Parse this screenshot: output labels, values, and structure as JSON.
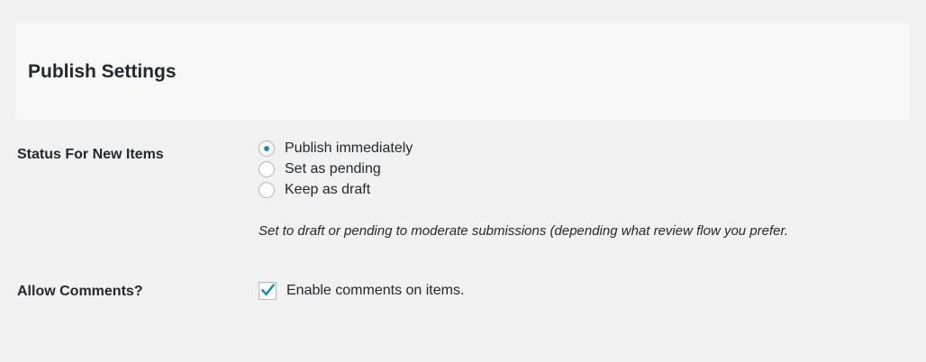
{
  "section": {
    "title": "Publish Settings"
  },
  "status_row": {
    "label": "Status For New Items",
    "options": [
      {
        "label": "Publish immediately",
        "checked": true
      },
      {
        "label": "Set as pending",
        "checked": false
      },
      {
        "label": "Keep as draft",
        "checked": false
      }
    ],
    "description": "Set to draft or pending to moderate submissions (depending what review flow you prefer."
  },
  "comments_row": {
    "label": "Allow Comments?",
    "checkbox_label": "Enable comments on items.",
    "checked": true
  },
  "colors": {
    "accent": "#1e8cbe",
    "background": "#f1f1f1",
    "header_background": "#f8f8f8",
    "text": "#23282d"
  }
}
